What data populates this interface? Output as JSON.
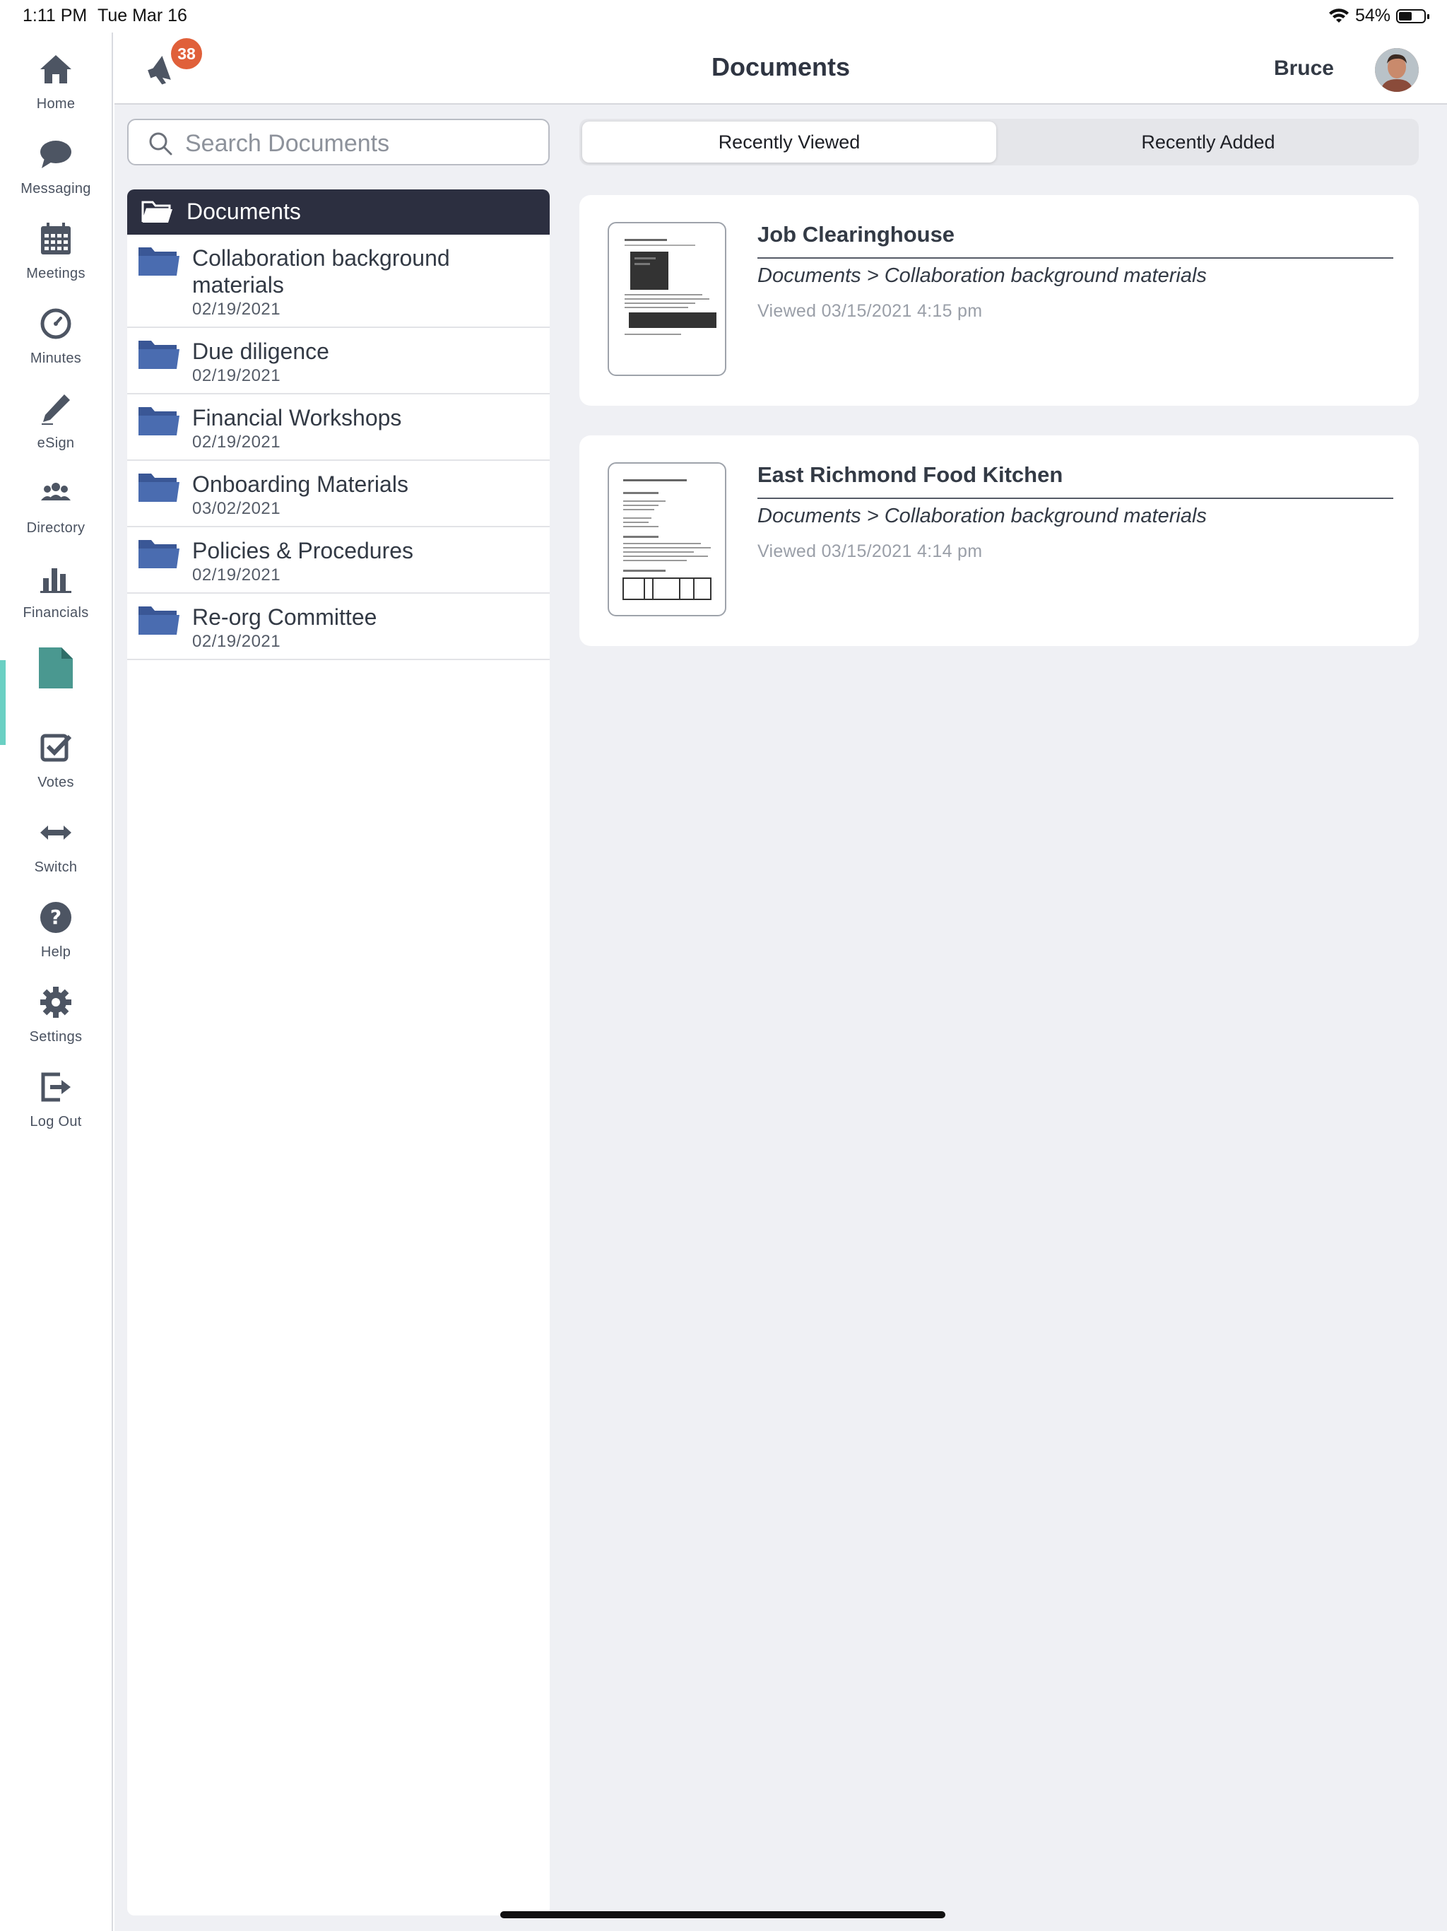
{
  "status_bar": {
    "time": "1:11 PM",
    "date": "Tue Mar 16",
    "battery_percent": "54%",
    "battery_level": 0.54
  },
  "header": {
    "title": "Documents",
    "notification_count": "38",
    "user_name": "Bruce"
  },
  "sidebar": {
    "items": [
      {
        "label": "Home",
        "icon": "home-icon"
      },
      {
        "label": "Messaging",
        "icon": "chat-bubble-icon"
      },
      {
        "label": "Meetings",
        "icon": "calendar-icon"
      },
      {
        "label": "Minutes",
        "icon": "clock-icon"
      },
      {
        "label": "eSign",
        "icon": "pen-icon"
      },
      {
        "label": "Directory",
        "icon": "people-icon"
      },
      {
        "label": "Financials",
        "icon": "bar-chart-icon"
      },
      {
        "label": "",
        "icon": "document-icon",
        "active": true
      },
      {
        "label": "Votes",
        "icon": "checkbox-icon"
      },
      {
        "label": "Switch",
        "icon": "double-arrow-icon"
      },
      {
        "label": "Help",
        "icon": "question-icon"
      },
      {
        "label": "Settings",
        "icon": "gear-icon"
      },
      {
        "label": "Log Out",
        "icon": "logout-icon"
      }
    ],
    "active_color": "#6ad0c3"
  },
  "search": {
    "placeholder": "Search Documents",
    "value": ""
  },
  "tree": {
    "root_label": "Documents",
    "folders": [
      {
        "name": "Collaboration background materials",
        "date": "02/19/2021"
      },
      {
        "name": "Due diligence",
        "date": "02/19/2021"
      },
      {
        "name": "Financial Workshops",
        "date": "02/19/2021"
      },
      {
        "name": "Onboarding Materials",
        "date": "03/02/2021"
      },
      {
        "name": "Policies & Procedures",
        "date": "02/19/2021"
      },
      {
        "name": "Re-org Committee",
        "date": "02/19/2021"
      }
    ]
  },
  "tabs": {
    "recently_viewed": "Recently Viewed",
    "recently_added": "Recently Added",
    "active": "recently_viewed"
  },
  "recent_documents": [
    {
      "title": "Job Clearinghouse",
      "path": "Documents > Collaboration  background materials",
      "viewed": "Viewed 03/15/2021 4:15 pm"
    },
    {
      "title": "East Richmond Food Kitchen",
      "path": "Documents > Collaboration  background materials",
      "viewed": "Viewed 03/15/2021 4:14 pm"
    }
  ],
  "colors": {
    "header_dark": "#2c2f40",
    "folder_blue": "#4a6cb0",
    "badge": "#e0603a",
    "background": "#eff0f4"
  }
}
